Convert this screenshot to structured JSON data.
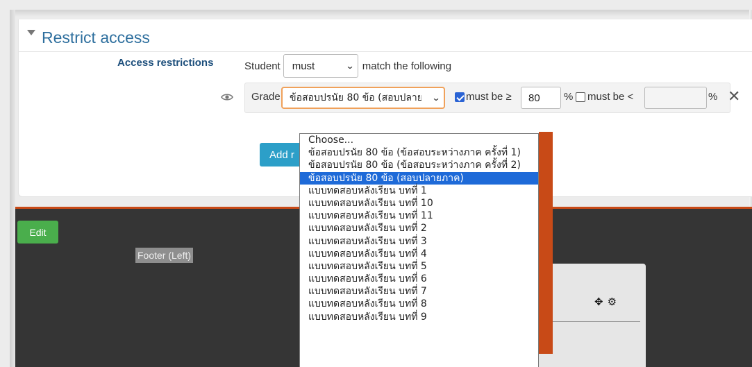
{
  "section": {
    "title": "Restrict access"
  },
  "access": {
    "label": "Access restrictions",
    "student_label": "Student",
    "must_value": "must",
    "match_text": "match the following",
    "add_button_label": "Add r"
  },
  "condition": {
    "type_label": "Grade",
    "selected_value": "ข้อสอบปรนัย 80 ข้อ (สอบปลายภาค)",
    "must_ge_label": "must be ≥",
    "must_ge_checked": true,
    "ge_value": "80",
    "percent_1": "%",
    "must_lt_label": "must be <",
    "must_lt_checked": false,
    "lt_value": "",
    "percent_2": "%",
    "delete_symbol": "✕"
  },
  "dropdown": {
    "options": [
      "Choose...",
      "ข้อสอบปรนัย 80 ข้อ (ข้อสอบระหว่างภาค ครั้งที่ 1)",
      "ข้อสอบปรนัย 80 ข้อ (ข้อสอบระหว่างภาค ครั้งที่ 2)",
      "ข้อสอบปรนัย 80 ข้อ (สอบปลายภาค)",
      "แบบทดสอบหลังเรียน บทที่ 1",
      "แบบทดสอบหลังเรียน บทที่ 10",
      "แบบทดสอบหลังเรียน บทที่ 11",
      "แบบทดสอบหลังเรียน บทที่ 2",
      "แบบทดสอบหลังเรียน บทที่ 3",
      "แบบทดสอบหลังเรียน บทที่ 4",
      "แบบทดสอบหลังเรียน บทที่ 5",
      "แบบทดสอบหลังเรียน บทที่ 6",
      "แบบทดสอบหลังเรียน บทที่ 7",
      "แบบทดสอบหลังเรียน บทที่ 8",
      "แบบทดสอบหลังเรียน บทที่ 9"
    ],
    "selected_index": 3
  },
  "footer": {
    "edit_label": "Edit",
    "footer_left_label": "Footer (Left)",
    "move_icon": "✥",
    "settings_icon": "⚙"
  },
  "colors": {
    "title_blue": "#2e6f9e",
    "accent_orange": "#c84a17",
    "button_blue": "#2c9fc8",
    "edit_green": "#4aae4c",
    "selected_option": "#1e6ad8"
  }
}
